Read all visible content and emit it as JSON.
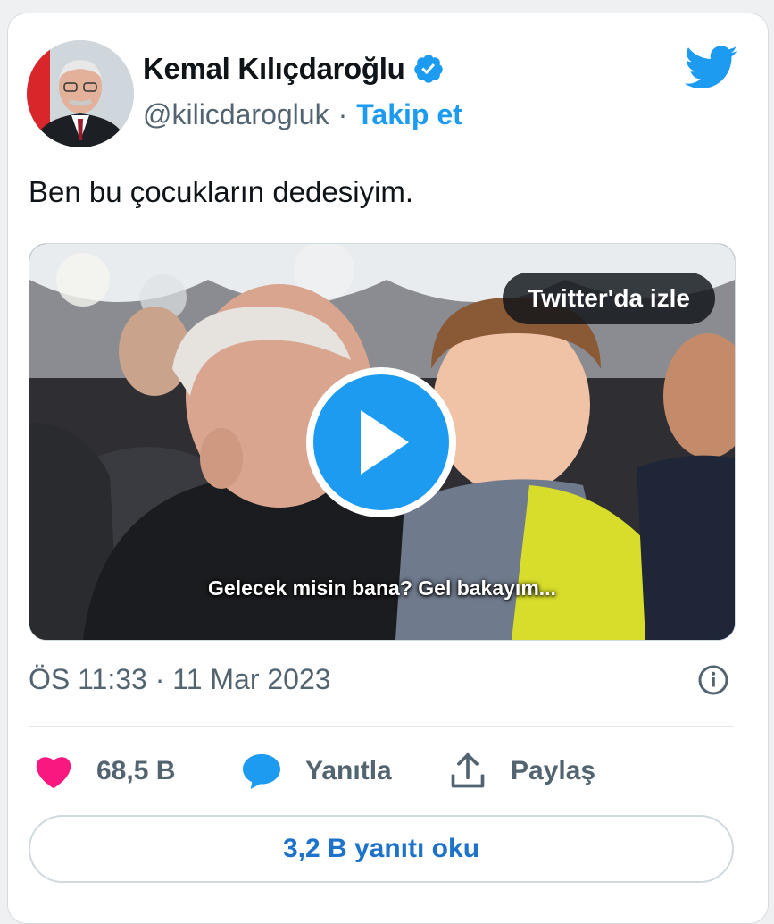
{
  "author": {
    "name": "Kemal Kılıçdaroğlu",
    "handle": "@kilicdarogluk",
    "separator": "·",
    "follow_label": "Takip et"
  },
  "tweet": {
    "text": "Ben bu çocukların dedesiyim.",
    "timestamp": "ÖS 11:33 · 11 Mar 2023"
  },
  "media": {
    "watch_label": "Twitter'da izle",
    "caption": "Gelecek misin bana? Gel bakayım..."
  },
  "actions": {
    "likes": "68,5 B",
    "reply_label": "Yanıtla",
    "share_label": "Paylaş"
  },
  "read_replies_label": "3,2 B yanıtı oku",
  "icons": {
    "verified": "verified-badge-icon",
    "bird": "twitter-bird-icon",
    "info": "info-icon",
    "heart": "heart-icon",
    "reply": "reply-bubble-icon",
    "share": "share-icon",
    "play": "play-icon"
  },
  "colors": {
    "accent": "#1d9bf0",
    "heart": "#f91880",
    "muted": "#536471"
  }
}
